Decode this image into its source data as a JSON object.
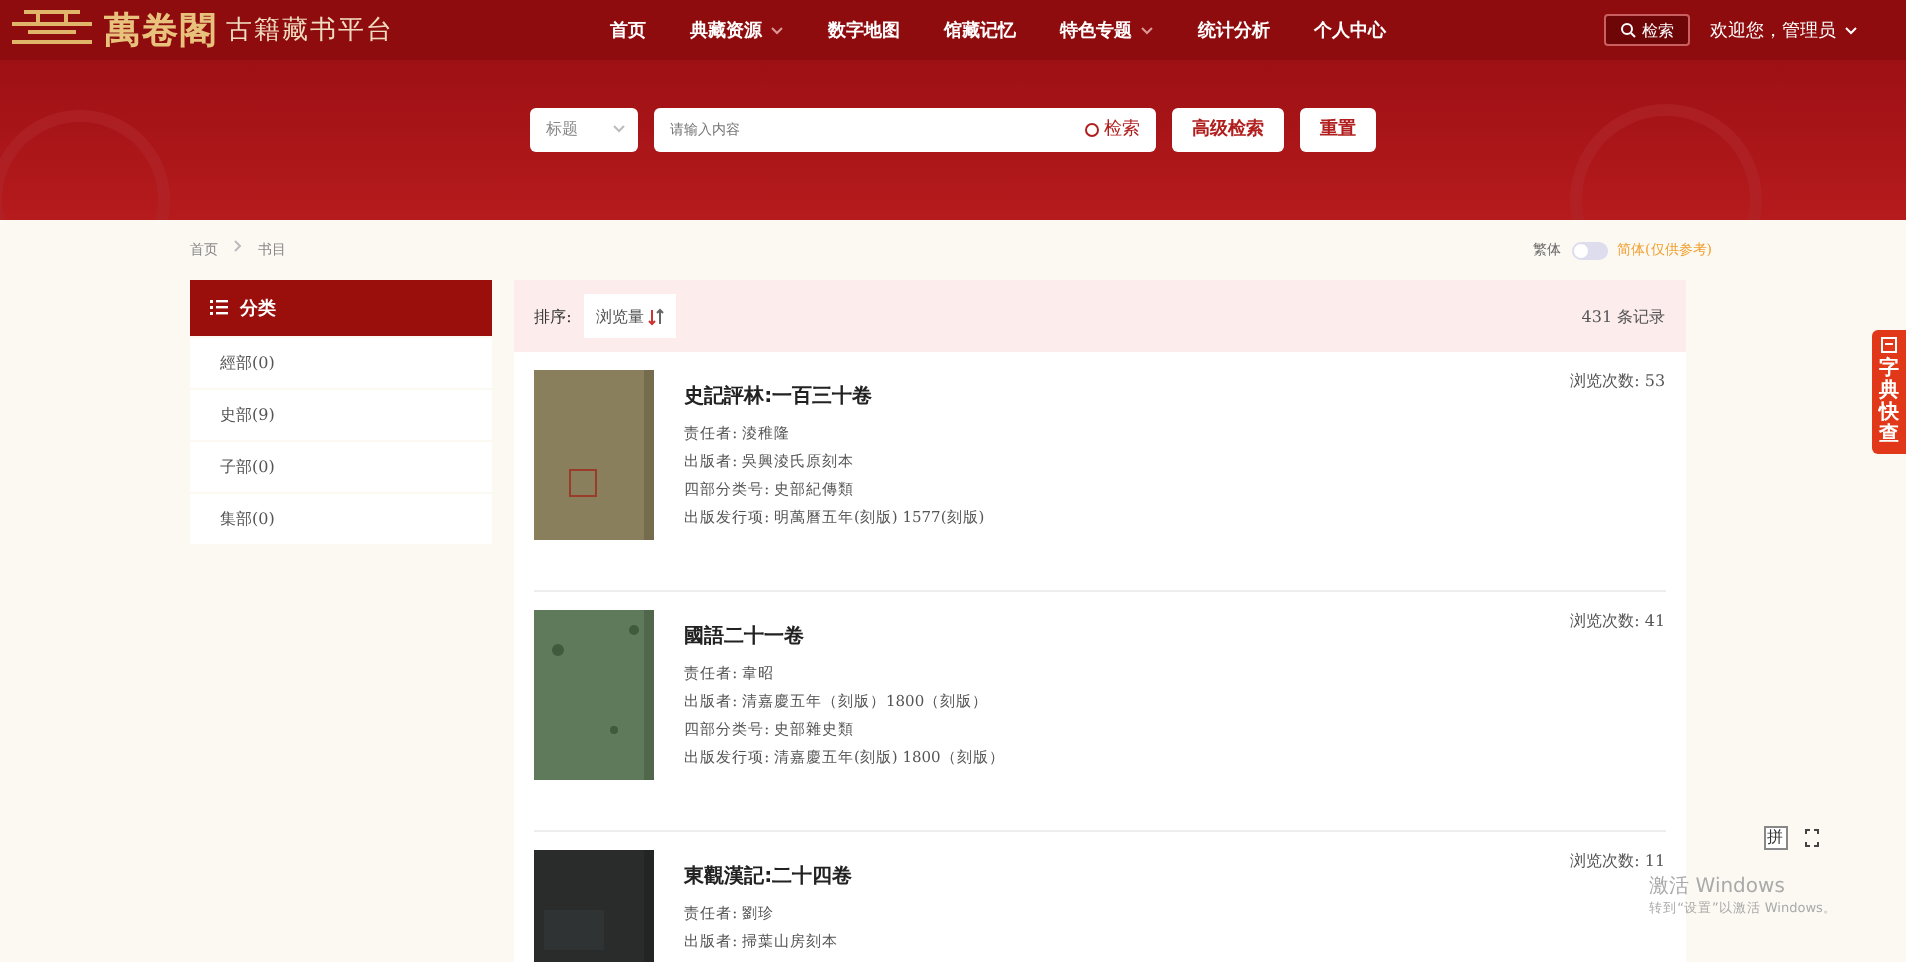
{
  "header": {
    "logo_title": "萬卷閣",
    "logo_subtitle": "古籍藏书平台",
    "nav": [
      {
        "label": "首页",
        "dropdown": false
      },
      {
        "label": "典藏资源",
        "dropdown": true
      },
      {
        "label": "数字地图",
        "dropdown": false
      },
      {
        "label": "馆藏记忆",
        "dropdown": false
      },
      {
        "label": "特色专题",
        "dropdown": true
      },
      {
        "label": "统计分析",
        "dropdown": false
      },
      {
        "label": "个人中心",
        "dropdown": false
      }
    ],
    "search_button": "检索",
    "user": "欢迎您，管理员"
  },
  "search": {
    "field_select": "标题",
    "placeholder": "请输入内容",
    "search_label": "检索",
    "advanced": "高级检索",
    "reset": "重置"
  },
  "breadcrumb": [
    "首页",
    "书目"
  ],
  "script_toggle": {
    "traditional": "繁体",
    "simplified": "简体(仅供参考)",
    "on": false
  },
  "sidebar": {
    "title": "分类",
    "items": [
      {
        "label": "經部(0)",
        "selected": false
      },
      {
        "label": "史部(9)",
        "selected": false
      },
      {
        "label": "子部(0)",
        "selected": false
      },
      {
        "label": "集部(0)",
        "selected": false
      }
    ]
  },
  "sort": {
    "label": "排序:",
    "option": "浏览量",
    "count": "431 条记录"
  },
  "records": [
    {
      "title": "史記評林:一百三十卷",
      "views": "浏览次数: 53",
      "fields": [
        {
          "label": "责任者:",
          "value": "淩稚隆"
        },
        {
          "label": "出版者:",
          "value": "吳興淩氏原刻本"
        },
        {
          "label": "四部分类号:",
          "value": "史部紀傳類"
        },
        {
          "label": "出版发行项:",
          "value": "明萬曆五年(刻版) 1577(刻版)"
        }
      ]
    },
    {
      "title": "國語二十一卷",
      "views": "浏览次数: 41",
      "fields": [
        {
          "label": "责任者:",
          "value": "韋昭"
        },
        {
          "label": "出版者:",
          "value": "清嘉慶五年（刻版）1800（刻版）"
        },
        {
          "label": "四部分类号:",
          "value": "史部雜史類"
        },
        {
          "label": "出版发行项:",
          "value": "清嘉慶五年(刻版) 1800（刻版）"
        }
      ]
    },
    {
      "title": "東觀漢記:二十四卷",
      "views": "浏览次数: 11",
      "fields": [
        {
          "label": "责任者:",
          "value": "劉珍"
        },
        {
          "label": "出版者:",
          "value": "掃葉山房刻本"
        }
      ]
    }
  ],
  "side_tab": "字典快查",
  "pinyin_key": "拼",
  "os_notice": {
    "title": "激活 Windows",
    "hint": "转到“设置”以激活 Windows。"
  }
}
